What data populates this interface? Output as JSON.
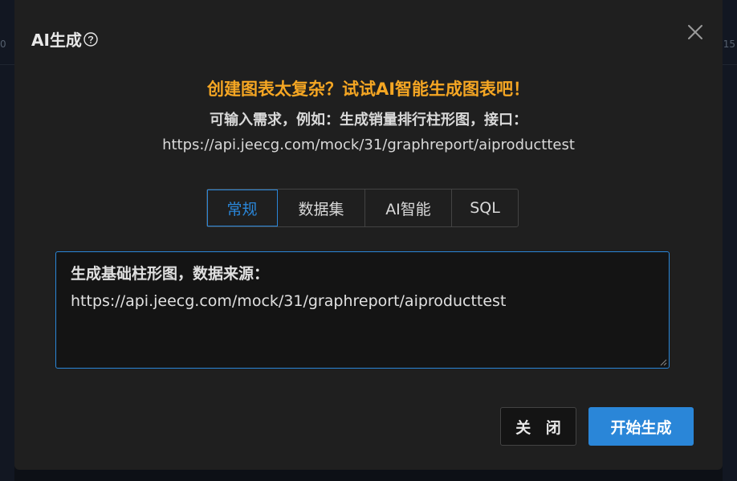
{
  "background": {
    "left_tick": "0",
    "right_tick": "15"
  },
  "modal": {
    "title": "AI生成",
    "headline": "创建图表太复杂？试试AI智能生成图表吧！",
    "subline": "可输入需求，例如：生成销量排行柱形图，接口：",
    "url": "https://api.jeecg.com/mock/31/graphreport/aiproducttest",
    "tabs": [
      {
        "label": "常规",
        "active": true
      },
      {
        "label": "数据集",
        "active": false
      },
      {
        "label": "AI智能",
        "active": false
      },
      {
        "label": "SQL",
        "active": false
      }
    ],
    "textarea": {
      "line1": "生成基础柱形图，数据来源：",
      "line2": "https://api.jeecg.com/mock/31/graphreport/aiproducttest"
    },
    "buttons": {
      "close_label": "关 闭",
      "start_label": "开始生成"
    }
  },
  "colors": {
    "accent": "#2a86d8",
    "headline": "#f5a623",
    "modal_bg": "#1f1f1f"
  }
}
